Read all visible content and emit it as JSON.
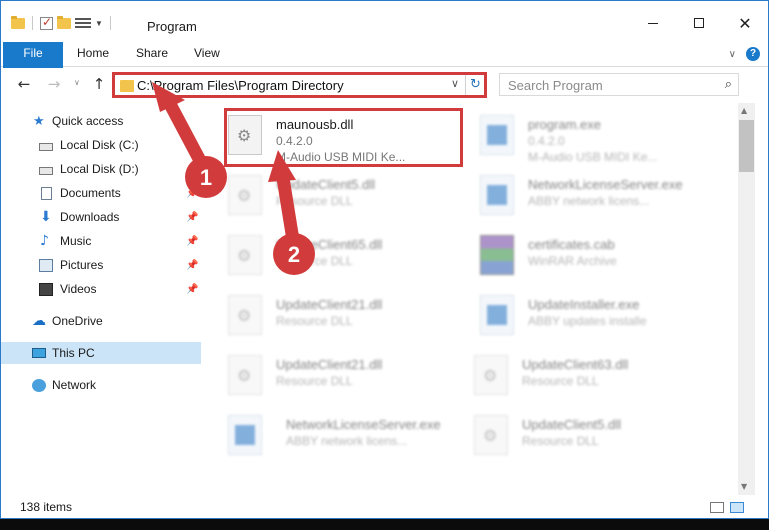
{
  "window": {
    "title": "Program",
    "tabs": [
      "File",
      "Home",
      "Share",
      "View"
    ]
  },
  "nav": {
    "address": "C:\\Program Files\\Program Directory",
    "search_placeholder": "Search Program"
  },
  "sidebar": {
    "items": [
      {
        "label": "Quick access",
        "icon": "star-icon"
      },
      {
        "label": "Local Disk (C:)",
        "icon": "drive-icon"
      },
      {
        "label": "Local Disk (D:)",
        "icon": "drive-icon"
      },
      {
        "label": "Documents",
        "icon": "documents-icon",
        "pinned": true
      },
      {
        "label": "Downloads",
        "icon": "downloads-icon",
        "pinned": true
      },
      {
        "label": "Music",
        "icon": "music-icon",
        "pinned": true
      },
      {
        "label": "Pictures",
        "icon": "pictures-icon",
        "pinned": true
      },
      {
        "label": "Videos",
        "icon": "videos-icon",
        "pinned": true
      },
      {
        "label": "OneDrive",
        "icon": "onedrive-icon"
      },
      {
        "label": "This PC",
        "icon": "pc-icon",
        "selected": true
      },
      {
        "label": "Network",
        "icon": "network-icon"
      }
    ]
  },
  "files": [
    {
      "name": "maunousb.dll",
      "line2": "0.4.2.0",
      "line3": "M-Audio USB MIDI Ke...",
      "type": "dll",
      "highlighted": true
    },
    {
      "name": "program.exe",
      "line2": "0.4.2.0",
      "line3": "M-Audio USB MIDI Ke...",
      "type": "exe"
    },
    {
      "name": "UpdateClient5.dll",
      "line2": "Resource DLL",
      "type": "dll"
    },
    {
      "name": "NetworkLicenseServer.exe",
      "line2": "ABBY network licens...",
      "type": "exe"
    },
    {
      "name": "UpdateClient65.dll",
      "line2": "Resource DLL",
      "type": "dll"
    },
    {
      "name": "certificates.cab",
      "line2": "WinRAR Archive",
      "type": "cab"
    },
    {
      "name": "UpdateClient21.dll",
      "line2": "Resource DLL",
      "type": "dll"
    },
    {
      "name": "UpdateInstaller.exe",
      "line2": "ABBY updates installe",
      "type": "exe"
    },
    {
      "name": "UpdateClient21.dll",
      "line2": "Resource DLL",
      "type": "dll"
    },
    {
      "name": "UpdateClient63.dll",
      "line2": "Resource DLL",
      "type": "dll"
    },
    {
      "name": "NetworkLicenseServer.exe",
      "line2": "ABBY network licens...",
      "type": "exe"
    },
    {
      "name": "UpdateClient5.dll",
      "line2": "Resource DLL",
      "type": "dll"
    }
  ],
  "annotations": {
    "step1": "1",
    "step2": "2",
    "color": "#d23b3b"
  },
  "status": {
    "item_count": "138 items"
  }
}
